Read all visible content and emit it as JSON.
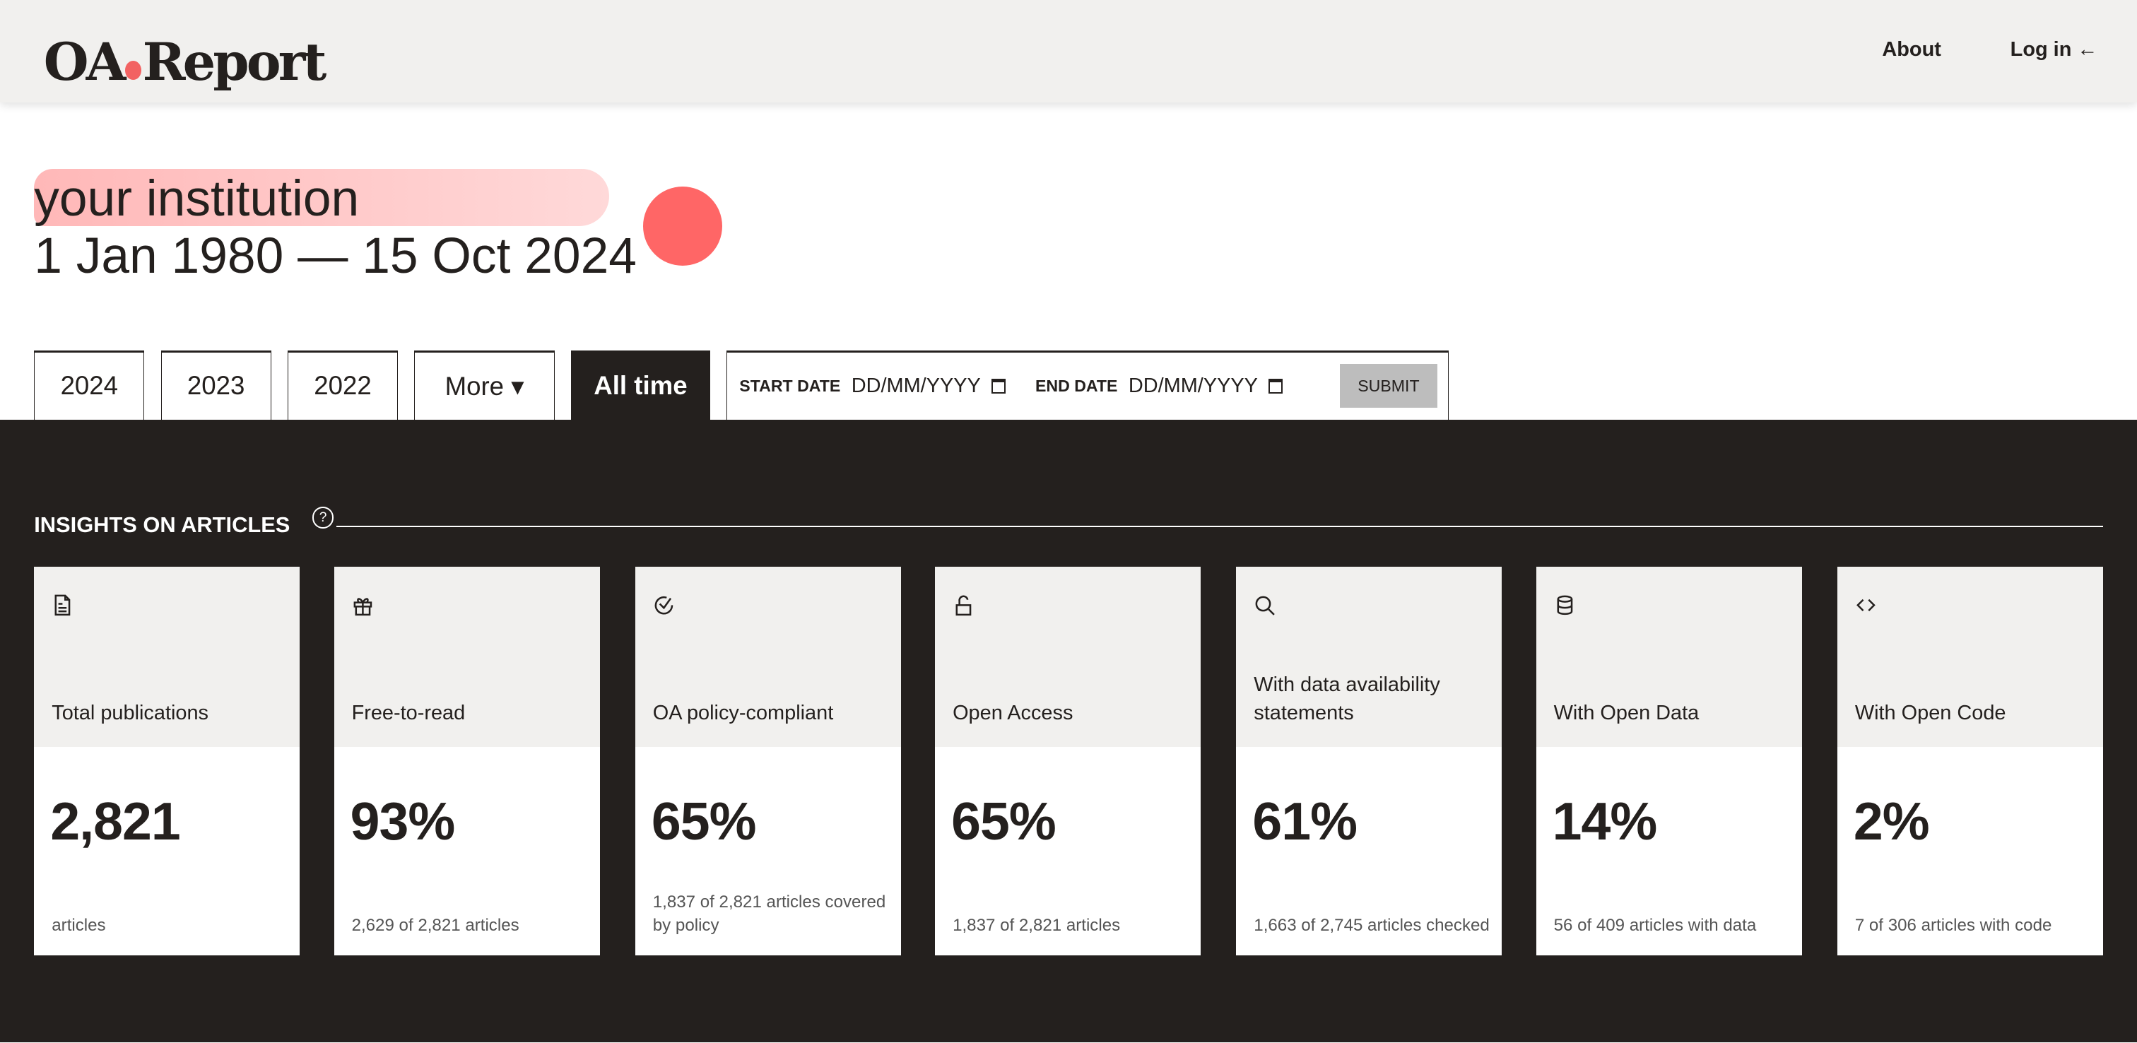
{
  "header": {
    "logo": "OA.Report",
    "nav": [
      {
        "label": "About"
      },
      {
        "label": "Log in ←"
      }
    ]
  },
  "hero": {
    "institution": "your institution",
    "date_range": "1 Jan 1980 — 15 Oct 2024",
    "accent": "#ff6666"
  },
  "filters": {
    "tabs": [
      {
        "label": "2024"
      },
      {
        "label": "2023"
      },
      {
        "label": "2022"
      },
      {
        "label": "More ▾"
      },
      {
        "label": "All time",
        "active": true
      }
    ],
    "start_label": "START DATE",
    "start_placeholder": "DD/MM/YYYY",
    "end_label": "END DATE",
    "end_placeholder": "DD/MM/YYYY",
    "submit": "SUBMIT"
  },
  "insights": {
    "title": "INSIGHTS ON ARTICLES",
    "help": "?",
    "cards": [
      {
        "icon": "document-icon",
        "label": "Total publications",
        "value": "2,821",
        "sub": "articles"
      },
      {
        "icon": "gift-icon",
        "label": "Free-to-read",
        "value": "93%",
        "sub": "2,629 of 2,821 articles"
      },
      {
        "icon": "check-circle-icon",
        "label": "OA policy-compliant",
        "value": "65%",
        "sub": "1,837 of 2,821 articles covered by policy"
      },
      {
        "icon": "unlock-icon",
        "label": "Open Access",
        "value": "65%",
        "sub": "1,837 of 2,821 articles"
      },
      {
        "icon": "search-icon",
        "label": "With data availability statements",
        "value": "61%",
        "sub": "1,663 of 2,745 articles checked"
      },
      {
        "icon": "database-icon",
        "label": "With Open Data",
        "value": "14%",
        "sub": "56 of 409 articles with data"
      },
      {
        "icon": "code-icon",
        "label": "With Open Code",
        "value": "2%",
        "sub": "7 of 306 articles with code"
      }
    ]
  }
}
